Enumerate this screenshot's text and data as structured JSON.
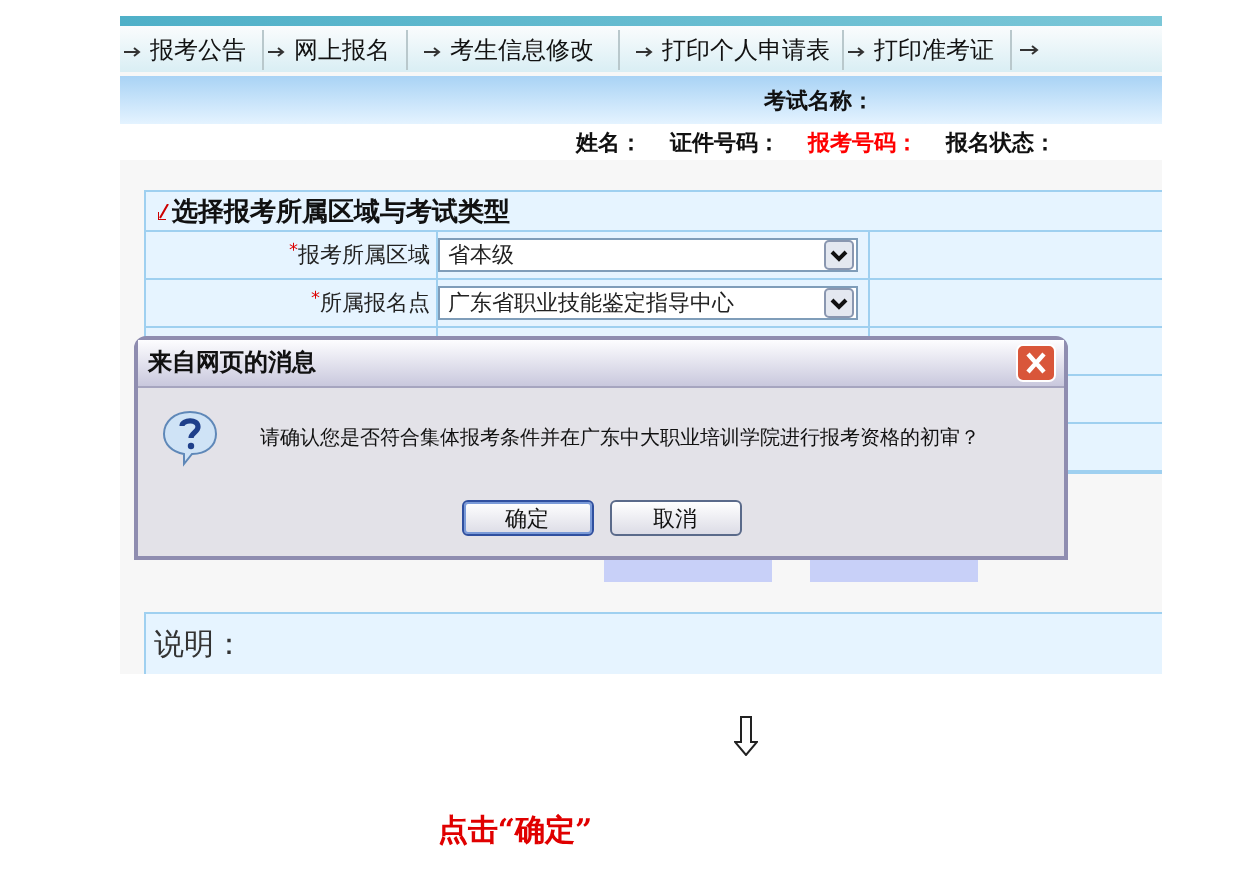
{
  "nav": [
    {
      "label": "报考公告"
    },
    {
      "label": "网上报名"
    },
    {
      "label": "考生信息修改"
    },
    {
      "label": "打印个人申请表"
    },
    {
      "label": "打印准考证"
    }
  ],
  "exam_info": {
    "exam_name_label": "考试名称：",
    "fields": [
      {
        "label": "姓名：",
        "highlight": false
      },
      {
        "label": "证件号码：",
        "highlight": false
      },
      {
        "label": "报考号码：",
        "highlight": true
      },
      {
        "label": "报名状态：",
        "highlight": false
      }
    ]
  },
  "form": {
    "title": "选择报考所属区域与考试类型",
    "rows": [
      {
        "mark": "*",
        "label": "报考所属区域",
        "value": "省本级"
      },
      {
        "mark": "*",
        "label": "所属报名点",
        "value": "广东省职业技能鉴定指导中心"
      }
    ]
  },
  "note": {
    "label": "说明："
  },
  "dialog": {
    "title": "来自网页的消息",
    "message": "请确认您是否符合集体报考条件并在广东中大职业培训学院进行报考资格的初审？",
    "buttons": [
      {
        "label": "确定",
        "selected": true
      },
      {
        "label": "取消",
        "selected": false
      }
    ]
  },
  "caption": "点击“确定”"
}
